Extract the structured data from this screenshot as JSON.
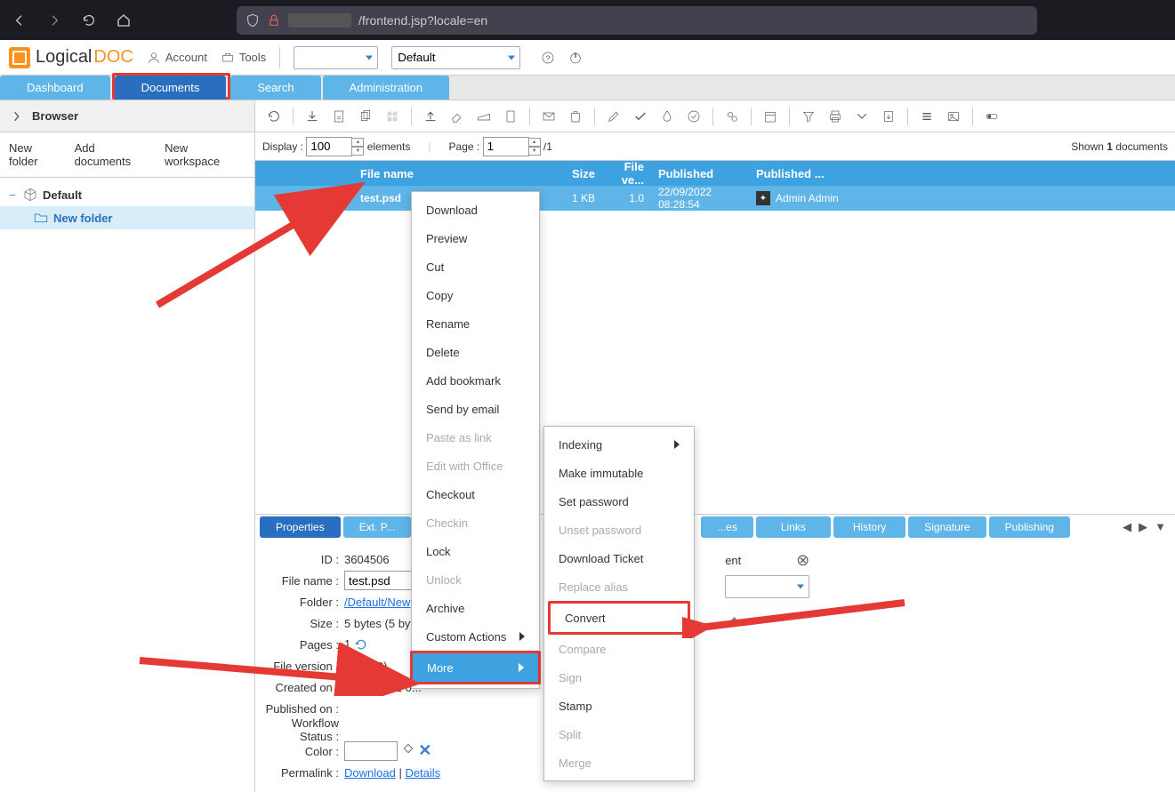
{
  "browser": {
    "url_suffix": "/frontend.jsp?locale=en"
  },
  "header": {
    "logo": {
      "part1": "Logical",
      "part2": "DOC"
    },
    "account": "Account",
    "tools": "Tools",
    "select1": "",
    "select2": "Default"
  },
  "main_tabs": [
    "Dashboard",
    "Documents",
    "Search",
    "Administration"
  ],
  "sidebar": {
    "title": "Browser",
    "actions": [
      "New folder",
      "Add documents",
      "New workspace"
    ],
    "tree": {
      "root": "Default",
      "child": "New folder"
    }
  },
  "pager": {
    "display_label": "Display :",
    "display_value": "100",
    "elements_label": "elements",
    "page_label": "Page :",
    "page_value": "1",
    "page_total": "/1",
    "shown": {
      "prefix": "Shown ",
      "count": "1",
      "suffix": " documents"
    }
  },
  "grid": {
    "headers": {
      "name": "File name",
      "size": "Size",
      "ver": "File ve...",
      "pub": "Published",
      "pubby": "Published ..."
    },
    "row": {
      "name": "test.psd",
      "size": "1 KB",
      "ver": "1.0",
      "pub": "22/09/2022 08:28:54",
      "pubby": "Admin Admin"
    }
  },
  "ctx1": {
    "download": "Download",
    "preview": "Preview",
    "cut": "Cut",
    "copy": "Copy",
    "rename": "Rename",
    "delete": "Delete",
    "bookmark": "Add bookmark",
    "email": "Send by email",
    "paste": "Paste as link",
    "office": "Edit with Office",
    "checkout": "Checkout",
    "checkin": "Checkin",
    "lock": "Lock",
    "unlock": "Unlock",
    "archive": "Archive",
    "custom": "Custom Actions",
    "more": "More"
  },
  "ctx2": {
    "indexing": "Indexing",
    "immutable": "Make immutable",
    "setpw": "Set password",
    "unsetpw": "Unset password",
    "ticket": "Download Ticket",
    "alias": "Replace alias",
    "convert": "Convert",
    "compare": "Compare",
    "sign": "Sign",
    "stamp": "Stamp",
    "split": "Split",
    "merge": "Merge"
  },
  "detail_tabs": [
    "Properties",
    "Ext. P...",
    "...es",
    "Links",
    "History",
    "Signature",
    "Publishing"
  ],
  "properties": {
    "id_label": "ID :",
    "id": "3604506",
    "filename_label": "File name :",
    "filename": "test.psd",
    "folder_label": "Folder :",
    "folder": "/Default/New",
    "size_label": "Size :",
    "size": "5 bytes (5 byte",
    "pages_label": "Pages :",
    "pages": "1",
    "filever_label": "File version :",
    "filever": "1.0 (1.0)",
    "created_label": "Created on :",
    "created": "22/09/2022 0...",
    "published_label": "Published on :",
    "workflow_label": "Workflow Status :",
    "color_label": "Color :",
    "permalink_label": "Permalink :",
    "permalink_download": "Download",
    "permalink_details": "Details",
    "type_label": "ent"
  }
}
